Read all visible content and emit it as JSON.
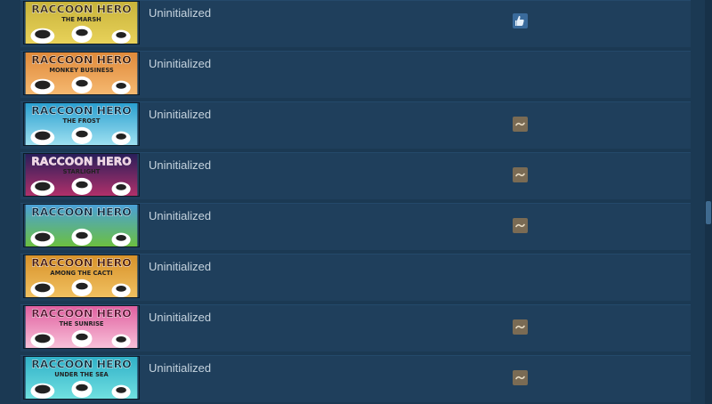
{
  "games": [
    {
      "status": "Uninitialized",
      "banner_title": "RACCOON HERO",
      "banner_subtitle": "THE MARSH",
      "icon": "thumbs-up-icon",
      "banner_bg": "#c8b33a",
      "banner_bg2": "#e8d25a",
      "banner_title_color": "#3a2a10"
    },
    {
      "status": "Uninitialized",
      "banner_title": "RACCOON HERO",
      "banner_subtitle": "MONKEY BUSINESS",
      "icon": "",
      "banner_bg": "#e08a3a",
      "banner_bg2": "#f5b870",
      "banner_title_color": "#3a1a08"
    },
    {
      "status": "Uninitialized",
      "banner_title": "RACCOON HERO",
      "banner_subtitle": "THE FROST",
      "icon": "mixed-review-icon",
      "banner_bg": "#2a9fd0",
      "banner_bg2": "#9ee0f0",
      "banner_title_color": "#0a2a40"
    },
    {
      "status": "Uninitialized",
      "banner_title": "RACCOON HERO",
      "banner_subtitle": "STARLIGHT",
      "icon": "mixed-review-icon",
      "banner_bg": "#2a1e5a",
      "banner_bg2": "#b0306a",
      "banner_title_color": "#f0d0e0"
    },
    {
      "status": "Uninitialized",
      "banner_title": "RACCOON HERO",
      "banner_subtitle": "",
      "icon": "mixed-review-icon",
      "banner_bg": "#4aa0d8",
      "banner_bg2": "#6cc040",
      "banner_title_color": "#0a2a40"
    },
    {
      "status": "Uninitialized",
      "banner_title": "RACCOON HERO",
      "banner_subtitle": "AMONG THE CACTI",
      "icon": "",
      "banner_bg": "#d8922a",
      "banner_bg2": "#f0c060",
      "banner_title_color": "#4a1a08"
    },
    {
      "status": "Uninitialized",
      "banner_title": "RACCOON HERO",
      "banner_subtitle": "THE SUNRISE",
      "icon": "mixed-review-icon",
      "banner_bg": "#e060a0",
      "banner_bg2": "#f8c0d8",
      "banner_title_color": "#5a1030"
    },
    {
      "status": "Uninitialized",
      "banner_title": "RACCOON HERO",
      "banner_subtitle": "UNDER THE SEA",
      "icon": "mixed-review-icon",
      "banner_bg": "#30b0c8",
      "banner_bg2": "#70e0e0",
      "banner_title_color": "#0a3040"
    }
  ]
}
